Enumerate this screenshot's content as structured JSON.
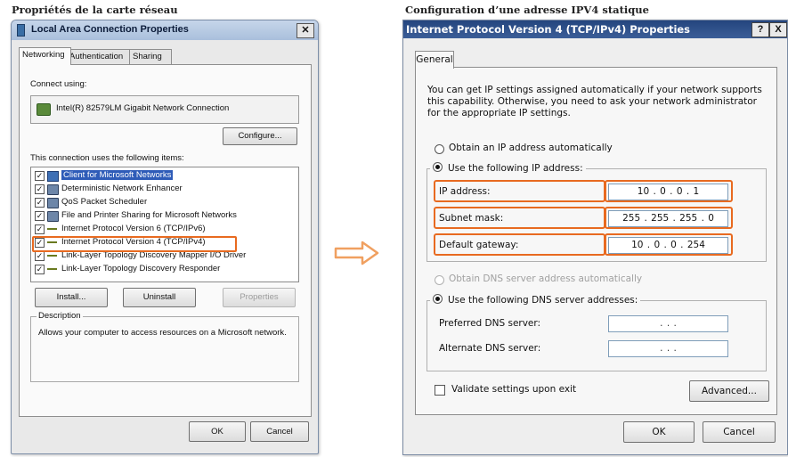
{
  "captions": {
    "left": "Propriétés de la carte réseau",
    "right": "Configuration d’une adresse IPV4 statique"
  },
  "lan_dialog": {
    "title": "Local Area Connection Properties",
    "close_label": "✕",
    "tabs": [
      "Networking",
      "Authentication",
      "Sharing"
    ],
    "connect_using_label": "Connect using:",
    "adapter_name": "Intel(R) 82579LM Gigabit Network Connection",
    "configure_label": "Configure...",
    "items_label": "This connection uses the following items:",
    "items": [
      {
        "label": "Client for Microsoft Networks",
        "checked": true,
        "icon": "client-icon",
        "selected": true
      },
      {
        "label": "Deterministic Network Enhancer",
        "checked": true,
        "icon": "computer-icon"
      },
      {
        "label": "QoS Packet Scheduler",
        "checked": true,
        "icon": "computer-icon"
      },
      {
        "label": "File and Printer Sharing for Microsoft Networks",
        "checked": true,
        "icon": "computer-icon"
      },
      {
        "label": "Internet Protocol Version 6 (TCP/IPv6)",
        "checked": true,
        "icon": "protocol-icon"
      },
      {
        "label": "Internet Protocol Version 4 (TCP/IPv4)",
        "checked": true,
        "icon": "protocol-icon",
        "highlighted": true
      },
      {
        "label": "Link-Layer Topology Discovery Mapper I/O Driver",
        "checked": true,
        "icon": "protocol-icon"
      },
      {
        "label": "Link-Layer Topology Discovery Responder",
        "checked": true,
        "icon": "protocol-icon"
      }
    ],
    "check_mark": "✓",
    "install_label": "Install...",
    "uninstall_label": "Uninstall",
    "properties_label": "Properties",
    "description_legend": "Description",
    "description_text": "Allows your computer to access resources on a Microsoft network.",
    "ok_label": "OK",
    "cancel_label": "Cancel"
  },
  "ipv4_dialog": {
    "title": "Internet Protocol Version 4 (TCP/IPv4) Properties",
    "help_label": "?",
    "close_label": "X",
    "tab_general": "General",
    "intro_text": "You can get IP settings assigned automatically if your network supports this capability. Otherwise, you need to ask your network administrator for the appropriate IP settings.",
    "radio_auto_ip": "Obtain an IP address automatically",
    "radio_static_ip": "Use the following IP address:",
    "ip_address_label": "IP address:",
    "ip_address_value": "10 . 0 . 0 . 1",
    "subnet_mask_label": "Subnet mask:",
    "subnet_mask_value": "255 . 255 . 255 . 0",
    "gateway_label": "Default gateway:",
    "gateway_value": "10 . 0 . 0 . 254",
    "radio_auto_dns": "Obtain DNS server address automatically",
    "radio_static_dns": "Use the following DNS server addresses:",
    "preferred_dns_label": "Preferred DNS server:",
    "preferred_dns_value": ".     .     .",
    "alternate_dns_label": "Alternate DNS server:",
    "alternate_dns_value": ".     .     .",
    "validate_label": "Validate settings upon exit",
    "advanced_label": "Advanced...",
    "ok_label": "OK",
    "cancel_label": "Cancel"
  },
  "colors": {
    "highlight": "#e86a20",
    "arrow": "#f0a060",
    "title_bar_right": "#2b4c86",
    "selection": "#2e5cb8"
  }
}
